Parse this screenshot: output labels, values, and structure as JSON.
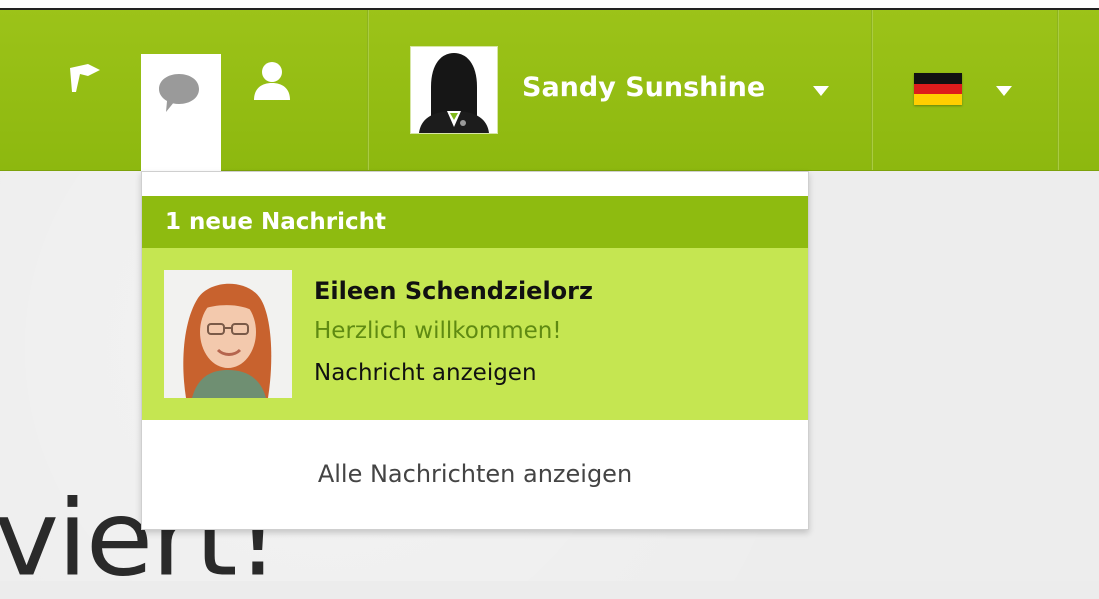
{
  "header": {
    "user": {
      "name": "Sandy Sunshine"
    },
    "language": {
      "selected": "de"
    },
    "icons": {
      "notifications": "flag-icon",
      "messages": "chat-bubble-icon",
      "contacts": "person-icon"
    }
  },
  "messages_dropdown": {
    "header": "1 neue Nachricht",
    "items": [
      {
        "sender": "Eileen Schendzielorz",
        "preview": "Herzlich willkommen!",
        "link": "Nachricht anzeigen"
      }
    ],
    "show_all": "Alle Nachrichten anzeigen"
  },
  "page": {
    "heading_fragment": "viert!"
  },
  "colors": {
    "bar": "#94be14",
    "dropdown_header": "#8ebb10",
    "message_bg": "#c5e651",
    "preview_text": "#5f8a12"
  }
}
